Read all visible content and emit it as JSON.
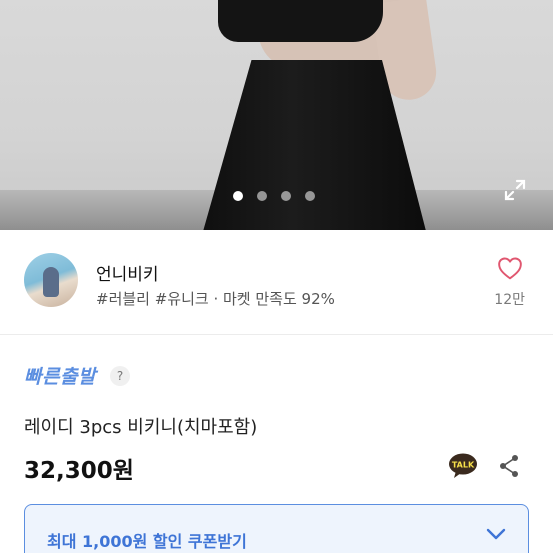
{
  "hero": {
    "slide_count": 4,
    "active_slide": 1,
    "expand_icon": "expand-icon"
  },
  "seller": {
    "name": "언니비키",
    "tags": "#러블리 #유니크 · 마켓 만족도 92%",
    "like_count": "12만",
    "like_icon": "heart-outline-icon"
  },
  "product": {
    "badge": "빠른출발",
    "help_symbol": "?",
    "title": "레이디 3pcs 비키니(치마포함)",
    "price": "32,300원",
    "talk_label": "TALK"
  },
  "coupon": {
    "label": "최대 1,000원 할인 쿠폰받기"
  },
  "colors": {
    "accent": "#5b8ee0",
    "heart": "#e0566f",
    "coupon_bg": "#eef4fd",
    "talk_bubble": "#3a2a1e"
  }
}
